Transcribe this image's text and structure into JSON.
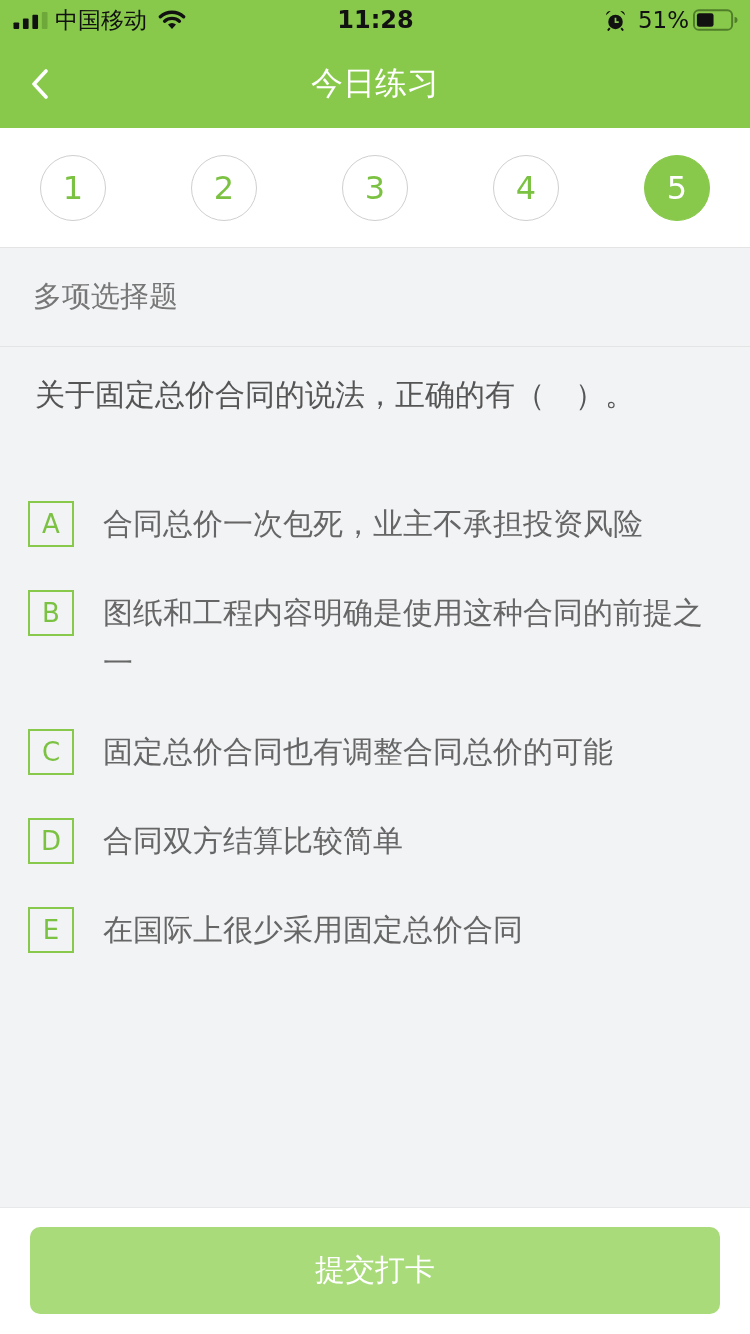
{
  "status_bar": {
    "carrier": "中国移动",
    "time": "11:28",
    "battery": "51%"
  },
  "nav_bar": {
    "title": "今日练习"
  },
  "question_nav": [
    {
      "label": "1",
      "selected": false
    },
    {
      "label": "2",
      "selected": false
    },
    {
      "label": "3",
      "selected": false
    },
    {
      "label": "4",
      "selected": false
    },
    {
      "label": "5",
      "selected": true
    }
  ],
  "question": {
    "type": "多项选择题",
    "stem": "关于固定总价合同的说法，正确的有（　）。",
    "options": [
      {
        "letter": "A",
        "text": "合同总价一次包死，业主不承担投资风险",
        "selected": false
      },
      {
        "letter": "B",
        "text": "图纸和工程内容明确是使用这种合同的前提之一",
        "selected": false
      },
      {
        "letter": "C",
        "text": "固定总价合同也有调整合同总价的可能",
        "selected": false
      },
      {
        "letter": "D",
        "text": "合同双方结算比较简单",
        "selected": false
      },
      {
        "letter": "E",
        "text": "在国际上很少采用固定总价合同",
        "selected": false
      }
    ]
  },
  "submit_button": {
    "label": "提交打卡",
    "disabled": true
  }
}
